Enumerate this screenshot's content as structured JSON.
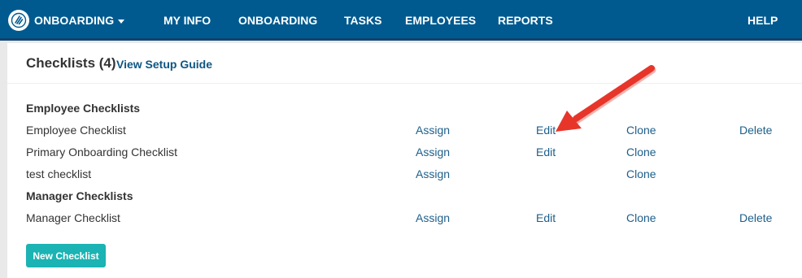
{
  "nav": {
    "brand_label": "ONBOARDING",
    "items": [
      {
        "label": "MY INFO"
      },
      {
        "label": "ONBOARDING"
      },
      {
        "label": "TASKS"
      },
      {
        "label": "EMPLOYEES"
      },
      {
        "label": "REPORTS"
      }
    ],
    "help_label": "HELP",
    "colors": {
      "bar": "#005a8f",
      "bar_border": "#0e4470"
    },
    "icons": {
      "brand": "hand-logo-icon",
      "dropdown": "caret-down-icon"
    }
  },
  "page": {
    "title": "Checklists (4)",
    "guide_link": "View Setup Guide"
  },
  "sections": [
    {
      "title": "Employee Checklists",
      "rows": [
        {
          "name": "Employee Checklist",
          "assign": "Assign",
          "edit": "Edit",
          "clone": "Clone",
          "delete": "Delete"
        },
        {
          "name": "Primary Onboarding Checklist",
          "assign": "Assign",
          "edit": "Edit",
          "clone": "Clone"
        },
        {
          "name": "test checklist",
          "assign": "Assign",
          "clone": "Clone"
        }
      ]
    },
    {
      "title": "Manager Checklists",
      "rows": [
        {
          "name": "Manager Checklist",
          "assign": "Assign",
          "edit": "Edit",
          "clone": "Clone",
          "delete": "Delete"
        }
      ]
    }
  ],
  "new_button": "New Checklist",
  "annotation": {
    "type": "red-arrow-icon",
    "color": "#e8352a",
    "points_to": "Edit"
  }
}
